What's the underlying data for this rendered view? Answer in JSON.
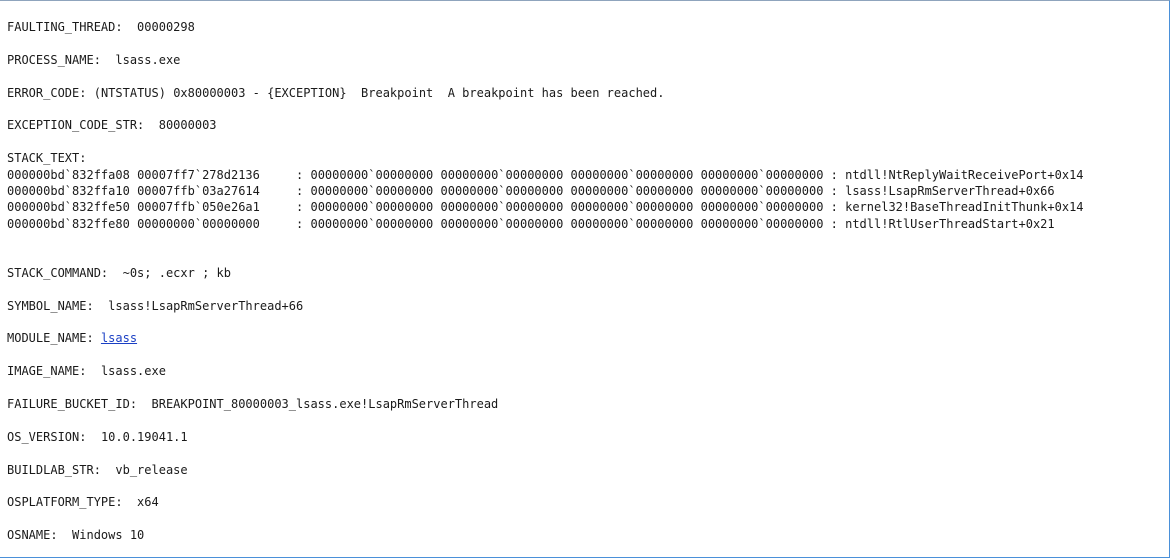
{
  "faulting_thread": {
    "key": "FAULTING_THREAD:",
    "value": "00000298"
  },
  "process_name": {
    "key": "PROCESS_NAME:",
    "value": "lsass.exe"
  },
  "error_code": {
    "key": "ERROR_CODE:",
    "value": "(NTSTATUS) 0x80000003 - {EXCEPTION}  Breakpoint  A breakpoint has been reached."
  },
  "exception_code_str": {
    "key": "EXCEPTION_CODE_STR:",
    "value": "80000003"
  },
  "stack_text": {
    "key": "STACK_TEXT:",
    "rows": [
      {
        "child_sp": "000000bd`832ffa08",
        "ret_addr": "00007ff7`278d2136",
        "args": ": 00000000`00000000 00000000`00000000 00000000`00000000 00000000`00000000",
        "call_site": ": ntdll!NtReplyWaitReceivePort+0x14"
      },
      {
        "child_sp": "000000bd`832ffa10",
        "ret_addr": "00007ffb`03a27614",
        "args": ": 00000000`00000000 00000000`00000000 00000000`00000000 00000000`00000000",
        "call_site": ": lsass!LsapRmServerThread+0x66"
      },
      {
        "child_sp": "000000bd`832ffe50",
        "ret_addr": "00007ffb`050e26a1",
        "args": ": 00000000`00000000 00000000`00000000 00000000`00000000 00000000`00000000",
        "call_site": ": kernel32!BaseThreadInitThunk+0x14"
      },
      {
        "child_sp": "000000bd`832ffe80",
        "ret_addr": "00000000`00000000",
        "args": ": 00000000`00000000 00000000`00000000 00000000`00000000 00000000`00000000",
        "call_site": ": ntdll!RtlUserThreadStart+0x21"
      }
    ]
  },
  "stack_command": {
    "key": "STACK_COMMAND:",
    "value": "~0s; .ecxr ; kb"
  },
  "symbol_name": {
    "key": "SYMBOL_NAME:",
    "value": "lsass!LsapRmServerThread+66"
  },
  "module_name": {
    "key": "MODULE_NAME:",
    "value": "lsass"
  },
  "image_name": {
    "key": "IMAGE_NAME:",
    "value": "lsass.exe"
  },
  "failure_bucket_id": {
    "key": "FAILURE_BUCKET_ID:",
    "value": "BREAKPOINT_80000003_lsass.exe!LsapRmServerThread"
  },
  "os_version": {
    "key": "OS_VERSION:",
    "value": "10.0.19041.1"
  },
  "buildlab_str": {
    "key": "BUILDLAB_STR:",
    "value": "vb_release"
  },
  "osplatform_type": {
    "key": "OSPLATFORM_TYPE:",
    "value": "x64"
  },
  "osname": {
    "key": "OSNAME:",
    "value": "Windows 10"
  },
  "colors": {
    "text": "#1a1a1a",
    "link": "#1a3fc4",
    "border": "#4a90d9"
  }
}
